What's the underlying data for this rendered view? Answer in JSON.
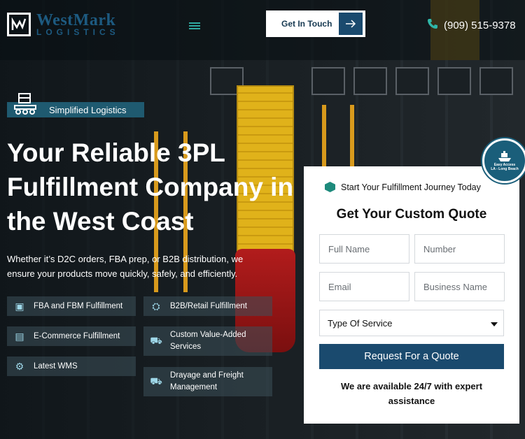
{
  "header": {
    "logo_line1": "WestMark",
    "logo_line2": "LOGISTICS",
    "cta_label": "Get In Touch",
    "phone": "(909) 515-9378"
  },
  "hero": {
    "badge": "Simplified Logistics",
    "title": "Your Reliable 3PL Fulfillment Company in the West Coast",
    "subtitle": "Whether it’s D2C orders, FBA prep, or B2B distribution, we ensure your products move quickly, safely, and efficiently.",
    "services": [
      {
        "label": "FBA and FBM Fulfillment",
        "icon": "package-icon"
      },
      {
        "label": "B2B/Retail Fulfillment",
        "icon": "handshake-icon"
      },
      {
        "label": "E-Commerce Fulfillment",
        "icon": "ecommerce-icon"
      },
      {
        "label": "Custom Value-Added Services",
        "icon": "value-added-icon"
      },
      {
        "label": "Latest WMS",
        "icon": "wms-icon"
      },
      {
        "label": "Drayage and Freight Management",
        "icon": "truck-icon"
      }
    ]
  },
  "quote_form": {
    "eyebrow": "Start Your Fulfillment Journey Today",
    "title": "Get Your Custom Quote",
    "full_name_placeholder": "Full Name",
    "number_placeholder": "Number",
    "email_placeholder": "Email",
    "business_placeholder": "Business Name",
    "service_select": "Type Of Service",
    "submit_label": "Request For a Quote",
    "availability": "We are available 24/7 with expert assistance"
  },
  "seal": {
    "line1": "Easy Access",
    "line2": "LA - Long Beach"
  },
  "colors": {
    "brand_blue": "#1a4a6e",
    "accent_teal": "#2fb7a8"
  }
}
